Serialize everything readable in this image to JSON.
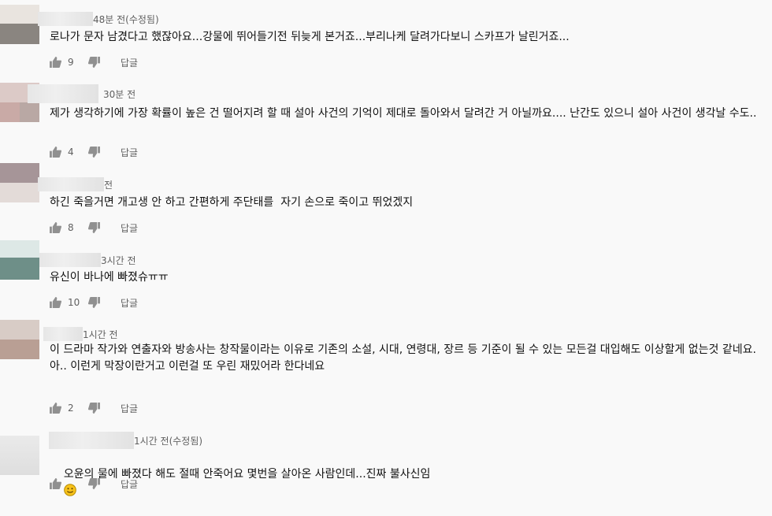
{
  "comments": [
    {
      "time": "48분 전(수정됨)",
      "text": "로나가 문자 남겼다고 했잖아요...강물에 뛰어들기전 뒤늦게 본거죠...부리나케 달려가다보니 스카프가 날린거죠...",
      "likes": "9",
      "reply_label": "답글"
    },
    {
      "time": "30분 전",
      "text": "제가 생각하기에 가장 확률이 높은 건 떨어지려 할 때 설아 사건의 기억이 제대로 돌아와서 달려간 거 아닐까요.... 난간도 있으니 설아 사건이 생각날 수도..",
      "likes": "4",
      "reply_label": "답글"
    },
    {
      "time": "전",
      "text": "하긴 죽을거면 개고생 안 하고 간편하게 주단태를  자기 손으로 죽이고 뛰었겠지",
      "likes": "8",
      "reply_label": "답글"
    },
    {
      "time": "3시간 전",
      "text": "유신이 바나에 빠졌슈ㅠㅠ",
      "likes": "10",
      "reply_label": "답글"
    },
    {
      "time": "1시간 전",
      "text": "이 드라마 작가와 연출자와 방송사는 창작물이라는 이유로 기존의 소설, 시대, 연령대, 장르 등 기준이 될 수 있는 모든걸 대입해도 이상할게 없는것 같네요.\n아.. 이런게 막장이란거고 이런걸 또 우린 재밌어라 한다네요",
      "likes": "2",
      "reply_label": "답글"
    },
    {
      "time": "1시간 전(수정됨)",
      "text": "오윤의 물에 빠졌다 해도 절때 안죽어요 몇번을 살아온 사람인데...진짜 불사신임",
      "likes": "",
      "reply_label": "답글"
    }
  ],
  "icons": {
    "like": "thumbs-up-icon",
    "dislike": "thumbs-down-icon",
    "emoji": "smiling-face-emoji"
  },
  "colors": {
    "background": "#f9f9f9",
    "text": "#111111",
    "meta": "#606060",
    "icon": "#909090"
  }
}
